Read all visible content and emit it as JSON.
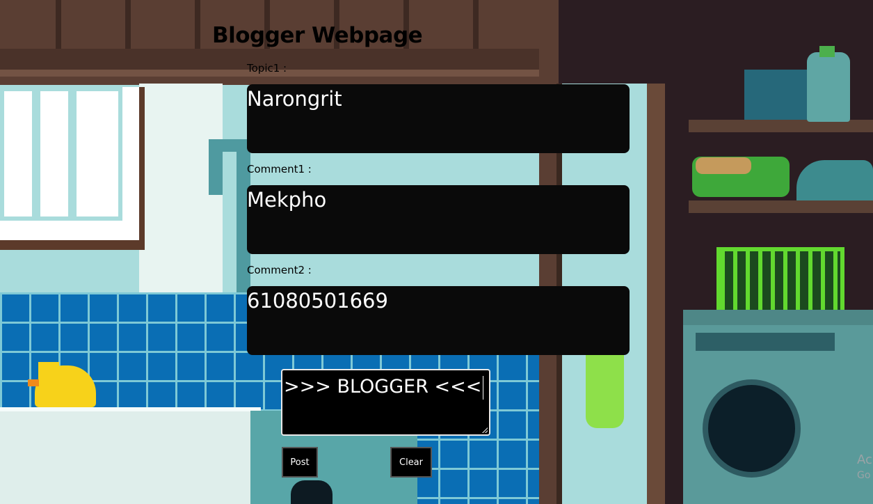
{
  "page": {
    "title": "Blogger Webpage"
  },
  "form": {
    "topic1": {
      "label": "Topic1 :",
      "value": "Narongrit"
    },
    "comment1": {
      "label": "Comment1 :",
      "value": "Mekpho"
    },
    "comment2": {
      "label": "Comment2 :",
      "value": "61080501669"
    },
    "blog_text": {
      "value": ">>> BLOGGER <<<"
    },
    "post_button": "Post",
    "clear_button": "Clear"
  },
  "watermark": {
    "line1": "Ac",
    "line2": "Go"
  },
  "colors": {
    "field_bg": "#0a0a0a",
    "field_text": "#ffffff",
    "title_text": "#000000"
  }
}
